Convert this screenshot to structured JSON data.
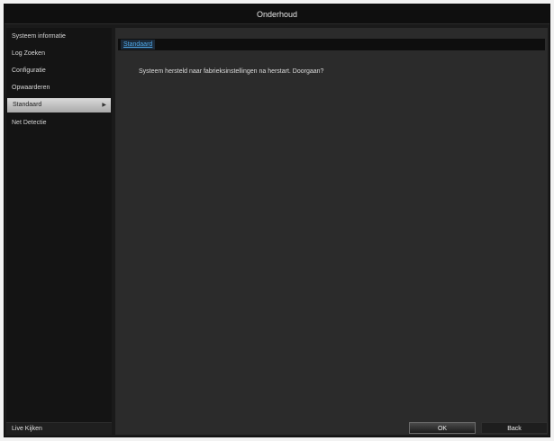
{
  "window": {
    "title": "Onderhoud"
  },
  "sidebar": {
    "items": [
      {
        "label": "Systeem informatie"
      },
      {
        "label": "Log Zoeken"
      },
      {
        "label": "Configuratie"
      },
      {
        "label": "Opwaarderen"
      },
      {
        "label": "Standaard",
        "active": true,
        "arrow": "▶"
      },
      {
        "label": "Net Detectie"
      }
    ],
    "bottom_label": "Live Kijken"
  },
  "content": {
    "tab_label": "Standaard",
    "message": "Systeem hersteld naar fabrieksinstellingen na herstart. Doorgaan?"
  },
  "buttons": {
    "ok_label": "OK",
    "back_label": "Back"
  },
  "colors": {
    "accent": "#4fa8e8",
    "background": "#2b2b2b",
    "sidebar": "#141414"
  }
}
